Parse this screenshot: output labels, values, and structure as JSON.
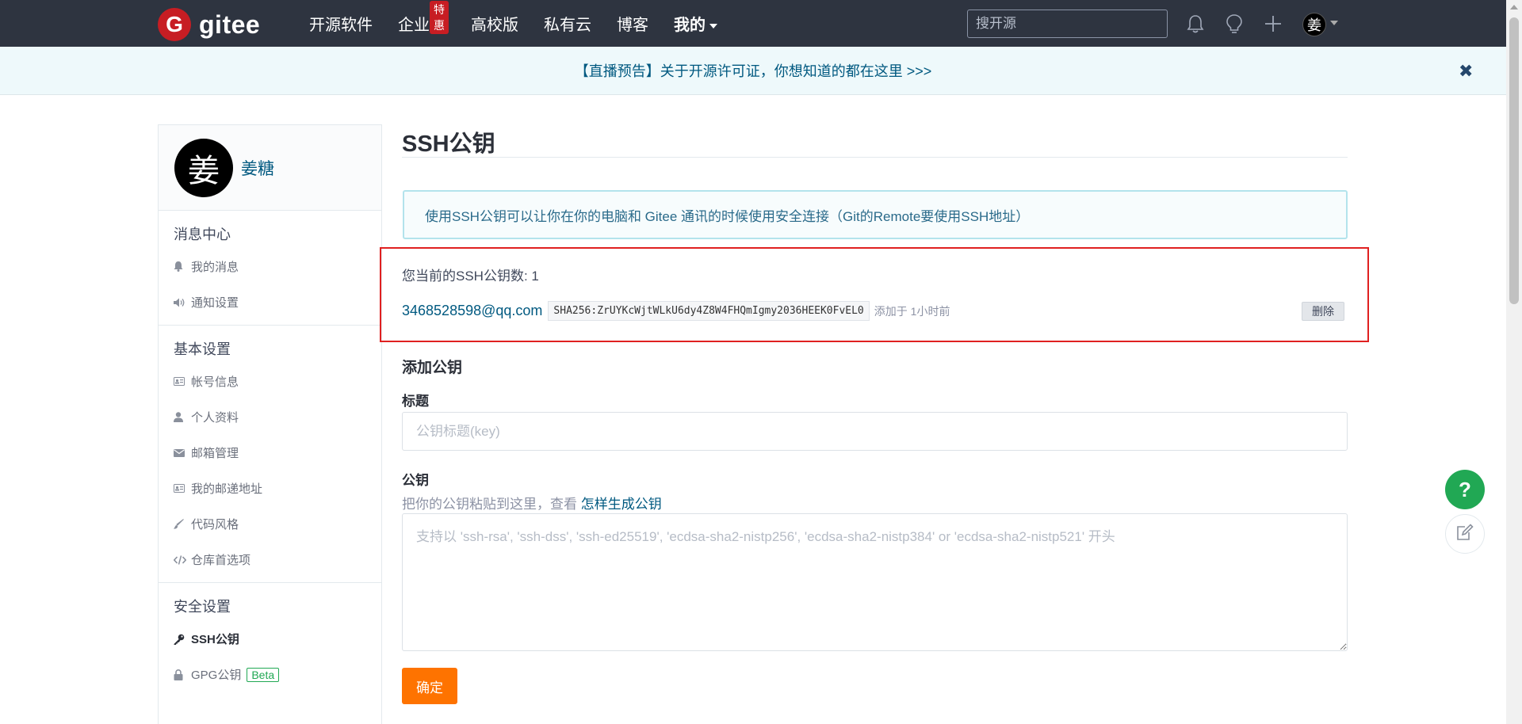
{
  "navbar": {
    "logo_mark": "G",
    "logo_text": "gitee",
    "menu": [
      {
        "label": "开源软件"
      },
      {
        "label": "企业版",
        "badge": "特惠"
      },
      {
        "label": "高校版"
      },
      {
        "label": "私有云"
      },
      {
        "label": "博客"
      },
      {
        "label": "我的"
      }
    ],
    "search_placeholder": "搜开源",
    "icons": [
      "bell-icon",
      "lightbulb-icon",
      "plus-icon"
    ],
    "avatar_char": "姜"
  },
  "announcement": {
    "text": "【直播预告】关于开源许可证，你想知道的都在这里 >>>",
    "close": "✖"
  },
  "sidebar": {
    "avatar_char": "姜",
    "username": "姜糖",
    "sections": [
      {
        "title": "消息中心",
        "items": [
          {
            "label": "我的消息",
            "icon": "bell-icon"
          },
          {
            "label": "通知设置",
            "icon": "speaker-icon"
          }
        ]
      },
      {
        "title": "基本设置",
        "items": [
          {
            "label": "帐号信息",
            "icon": "id-card-icon"
          },
          {
            "label": "个人资料",
            "icon": "user-icon"
          },
          {
            "label": "邮箱管理",
            "icon": "envelope-icon"
          },
          {
            "label": "我的邮递地址",
            "icon": "address-card-icon"
          },
          {
            "label": "代码风格",
            "icon": "brush-icon"
          },
          {
            "label": "仓库首选项",
            "icon": "code-icon"
          }
        ]
      },
      {
        "title": "安全设置",
        "items": [
          {
            "label": "SSH公钥",
            "icon": "key-icon",
            "active": true
          },
          {
            "label": "GPG公钥",
            "icon": "lock-icon",
            "badge": "Beta"
          }
        ]
      }
    ]
  },
  "main": {
    "title": "SSH公钥",
    "info": "使用SSH公钥可以让你在你的电脑和 Gitee 通讯的时候使用安全连接（Git的Remote要使用SSH地址）",
    "key_count": "您当前的SSH公钥数: 1",
    "key": {
      "email": "3468528598@qq.com",
      "fingerprint": "SHA256:ZrUYKcWjtWLkU6dy4Z8W4FHQmIgmy2036HEEK0FvEL0",
      "added": "添加于 1小时前",
      "delete_label": "删除"
    },
    "add_title": "添加公钥",
    "label_title": "标题",
    "title_placeholder": "公钥标题(key)",
    "label_key": "公钥",
    "hint_prefix": "把你的公钥粘贴到这里，查看",
    "hint_link": "怎样生成公钥",
    "key_placeholder": "支持以 'ssh-rsa', 'ssh-dss', 'ssh-ed25519', 'ecdsa-sha2-nistp256', 'ecdsa-sha2-nistp384' or 'ecdsa-sha2-nistp521' 开头",
    "confirm_label": "确定"
  },
  "floating": {
    "help": "?"
  }
}
